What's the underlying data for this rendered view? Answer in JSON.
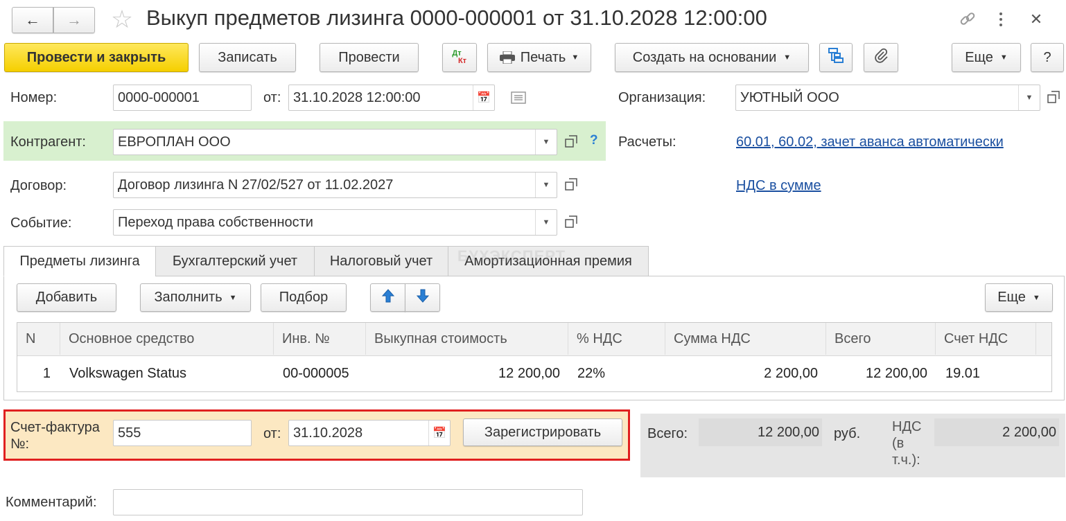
{
  "window": {
    "title": "Выкуп предметов лизинга 0000-000001 от 31.10.2028 12:00:00"
  },
  "toolbar": {
    "post_close": "Провести и закрыть",
    "save": "Записать",
    "post": "Провести",
    "dtkt_top": "Дт",
    "dtkt_bottom": "Кт",
    "print": "Печать",
    "create_based": "Создать на основании",
    "more": "Еще",
    "help": "?"
  },
  "form": {
    "number_label": "Номер:",
    "number_value": "0000-000001",
    "date_label": "от:",
    "date_value": "31.10.2028 12:00:00",
    "org_label": "Организация:",
    "org_value": "УЮТНЫЙ ООО",
    "counterparty_label": "Контрагент:",
    "counterparty_value": "ЕВРОПЛАН ООО",
    "help_mark": "?",
    "settlements_label": "Расчеты:",
    "settlements_link": "60.01, 60.02, зачет аванса автоматически",
    "contract_label": "Договор:",
    "contract_value": "Договор лизинга N 27/02/527 от 11.02.2027",
    "vat_link": "НДС в сумме",
    "event_label": "Событие:",
    "event_value": "Переход права собственности"
  },
  "tabs": [
    {
      "label": "Предметы лизинга"
    },
    {
      "label": "Бухгалтерский учет"
    },
    {
      "label": "Налоговый учет"
    },
    {
      "label": "Амортизационная премия"
    }
  ],
  "table_toolbar": {
    "add": "Добавить",
    "fill": "Заполнить",
    "select": "Подбор",
    "more": "Еще"
  },
  "table": {
    "columns": [
      "N",
      "Основное средство",
      "Инв. №",
      "Выкупная стоимость",
      "% НДС",
      "Сумма НДС",
      "Всего",
      "Счет НДС"
    ],
    "rows": [
      [
        "1",
        "Volkswagen Status",
        "00-000005",
        "12 200,00",
        "22%",
        "2 200,00",
        "12 200,00",
        "19.01"
      ]
    ]
  },
  "invoice": {
    "label": "Счет-фактура №:",
    "number": "555",
    "date_label": "от:",
    "date": "31.10.2028",
    "register_button": "Зарегистрировать"
  },
  "totals": {
    "total_label": "Всего:",
    "total_value": "12 200,00",
    "currency": "руб.",
    "vat_label": "НДС (в т.ч.):",
    "vat_value": "2 200,00"
  },
  "comment": {
    "label": "Комментарий:",
    "value": ""
  },
  "watermark": "БУХЭКСПЕРТ",
  "colors": {
    "primary_button": "#f5cf00",
    "counterparty_bg": "#d8f0cf",
    "invoice_bg": "#fce8c2",
    "invoice_border": "#e02020",
    "totals_bg": "#e5e5e5",
    "link": "#1a4fa0",
    "arrow_icon": "#2a7fd4"
  }
}
